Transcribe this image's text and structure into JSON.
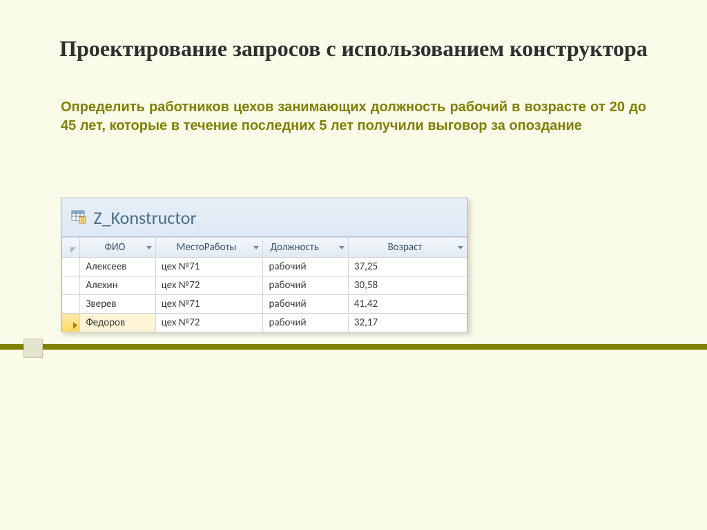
{
  "slide": {
    "title": "Проектирование запросов с использованием конструктора",
    "subtitle": "Определить работников цехов занимающих должность рабочий в возрасте от 20 до 45 лет, которые в течение последних 5 лет получили выговор за опоздание"
  },
  "access": {
    "tab_label": "Z_Konstructor",
    "columns": {
      "fio": "ФИО",
      "mesto": "МестоРаботы",
      "dolzh": "Должность",
      "vozr": "Возраст"
    },
    "rows": [
      {
        "fio": "Алексеев",
        "mesto": "цех №71",
        "dolzh": "рабочий",
        "vozr": "37,25"
      },
      {
        "fio": "Алехин",
        "mesto": "цех №72",
        "dolzh": "рабочий",
        "vozr": "30,58"
      },
      {
        "fio": "Зверев",
        "mesto": "цех №71",
        "dolzh": "рабочий",
        "vozr": "41,42"
      },
      {
        "fio": "Федоров",
        "mesto": "цех №72",
        "dolzh": "рабочий",
        "vozr": "32,17"
      }
    ]
  }
}
